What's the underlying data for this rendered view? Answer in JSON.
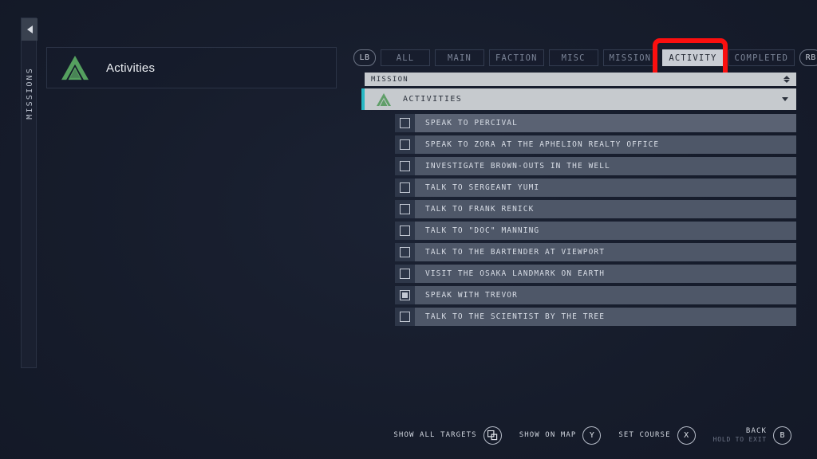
{
  "sidebar": {
    "collapse_icon": "triangle-left-icon",
    "label": "MISSIONS"
  },
  "detail_panel": {
    "icon": "activities-triangle-logo",
    "title": "Activities"
  },
  "filters": {
    "left_bumper": "LB",
    "right_bumper": "RB",
    "tabs": [
      {
        "label": "ALL",
        "active": false
      },
      {
        "label": "MAIN",
        "active": false
      },
      {
        "label": "FACTION",
        "active": false
      },
      {
        "label": "MISC",
        "active": false
      },
      {
        "label": "MISSION",
        "active": false
      },
      {
        "label": "ACTIVITY",
        "active": true
      },
      {
        "label": "COMPLETED",
        "active": false
      }
    ]
  },
  "annotation": {
    "target": "ACTIVITY",
    "color": "#fb0f0f"
  },
  "sort_bar": {
    "label": "MISSION",
    "icon": "sort-updown-icon"
  },
  "group": {
    "icon": "activities-triangle-logo",
    "title": "ACTIVITIES",
    "expand_icon": "chevron-down-icon",
    "accent_color": "#27b8c4"
  },
  "objectives": [
    {
      "label": "SPEAK TO PERCIVAL",
      "checked": false
    },
    {
      "label": "SPEAK TO ZORA AT THE APHELION REALTY OFFICE",
      "checked": false
    },
    {
      "label": "INVESTIGATE BROWN-OUTS IN THE WELL",
      "checked": false
    },
    {
      "label": "TALK TO SERGEANT YUMI",
      "checked": false
    },
    {
      "label": "TALK TO FRANK RENICK",
      "checked": false
    },
    {
      "label": "TALK TO \"DOC\" MANNING",
      "checked": false
    },
    {
      "label": "TALK TO THE BARTENDER AT VIEWPORT",
      "checked": false
    },
    {
      "label": "VISIT THE OSAKA LANDMARK ON EARTH",
      "checked": false
    },
    {
      "label": "SPEAK WITH TREVOR",
      "checked": true
    },
    {
      "label": "TALK TO THE SCIENTIST BY THE TREE",
      "checked": false
    }
  ],
  "bottom_prompts": [
    {
      "label": "SHOW ALL TARGETS",
      "sub": "",
      "button": "",
      "icon": "duplicate-squares-icon"
    },
    {
      "label": "SHOW ON MAP",
      "sub": "",
      "button": "Y",
      "icon": ""
    },
    {
      "label": "SET COURSE",
      "sub": "",
      "button": "X",
      "icon": ""
    },
    {
      "label": "BACK",
      "sub": "HOLD TO EXIT",
      "button": "B",
      "icon": ""
    }
  ]
}
